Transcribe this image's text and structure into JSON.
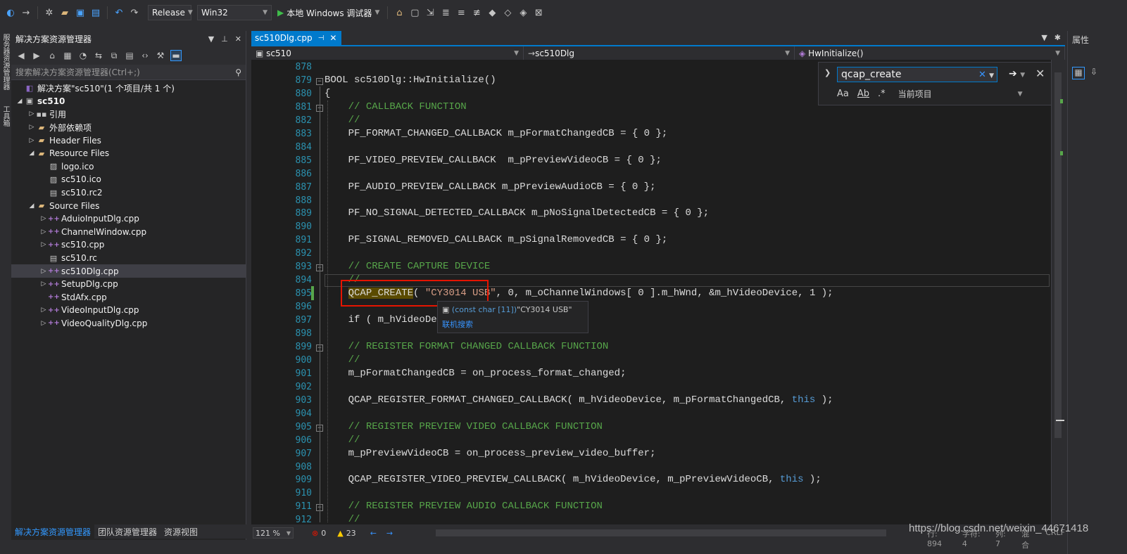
{
  "toolbar": {
    "config": "Release",
    "platform": "Win32",
    "run_label": "本地 Windows 调试器"
  },
  "left_strip": {
    "tabs": [
      "服务器资源管理器",
      "工具箱"
    ]
  },
  "solution_explorer": {
    "title": "解决方案资源管理器",
    "search_placeholder": "搜索解决方案资源管理器(Ctrl+;)",
    "tree": [
      {
        "label": "解决方案\"sc510\"(1 个项目/共 1 个)",
        "indent": 0,
        "twisty": "",
        "icon": "solution-icon",
        "selected": false
      },
      {
        "label": "sc510",
        "indent": 0,
        "twisty": "◢",
        "icon": "project-icon",
        "selected": false
      },
      {
        "label": "引用",
        "indent": 1,
        "twisty": "▷",
        "icon": "references-icon",
        "selected": false
      },
      {
        "label": "外部依赖项",
        "indent": 1,
        "twisty": "▷",
        "icon": "folder-icon",
        "selected": false
      },
      {
        "label": "Header Files",
        "indent": 1,
        "twisty": "▷",
        "icon": "folder-icon",
        "selected": false
      },
      {
        "label": "Resource Files",
        "indent": 1,
        "twisty": "◢",
        "icon": "folder-icon",
        "selected": false
      },
      {
        "label": "logo.ico",
        "indent": 2,
        "twisty": "",
        "icon": "image-file-icon",
        "selected": false
      },
      {
        "label": "sc510.ico",
        "indent": 2,
        "twisty": "",
        "icon": "image-file-icon",
        "selected": false
      },
      {
        "label": "sc510.rc2",
        "indent": 2,
        "twisty": "",
        "icon": "resource-file-icon",
        "selected": false
      },
      {
        "label": "Source Files",
        "indent": 1,
        "twisty": "◢",
        "icon": "folder-icon",
        "selected": false
      },
      {
        "label": "AduioInputDlg.cpp",
        "indent": 2,
        "twisty": "▷",
        "icon": "cpp-file-icon",
        "selected": false
      },
      {
        "label": "ChannelWindow.cpp",
        "indent": 2,
        "twisty": "▷",
        "icon": "cpp-file-icon",
        "selected": false
      },
      {
        "label": "sc510.cpp",
        "indent": 2,
        "twisty": "▷",
        "icon": "cpp-file-icon",
        "selected": false
      },
      {
        "label": "sc510.rc",
        "indent": 2,
        "twisty": "",
        "icon": "resource-file-icon",
        "selected": false
      },
      {
        "label": "sc510Dlg.cpp",
        "indent": 2,
        "twisty": "▷",
        "icon": "cpp-file-icon",
        "selected": true
      },
      {
        "label": "SetupDlg.cpp",
        "indent": 2,
        "twisty": "▷",
        "icon": "cpp-file-icon",
        "selected": false
      },
      {
        "label": "StdAfx.cpp",
        "indent": 2,
        "twisty": "",
        "icon": "cpp-file-icon",
        "selected": false
      },
      {
        "label": "VideoInputDlg.cpp",
        "indent": 2,
        "twisty": "▷",
        "icon": "cpp-file-icon",
        "selected": false
      },
      {
        "label": "VideoQualityDlg.cpp",
        "indent": 2,
        "twisty": "▷",
        "icon": "cpp-file-icon",
        "selected": false
      }
    ],
    "bottom_tabs": [
      "解决方案资源管理器",
      "团队资源管理器",
      "资源视图"
    ]
  },
  "editor": {
    "tab_label": "sc510Dlg.cpp",
    "nav": {
      "project": "sc510",
      "class": "sc510Dlg",
      "member": "HwInitialize()"
    },
    "lines": [
      {
        "n": "878",
        "html": ""
      },
      {
        "n": "879",
        "html": "BOOL sc510Dlg::HwInitialize()"
      },
      {
        "n": "880",
        "html": "{"
      },
      {
        "n": "881",
        "html": "    <span class=\"cm\">// CALLBACK FUNCTION</span>"
      },
      {
        "n": "882",
        "html": "    <span class=\"cm\">//</span>"
      },
      {
        "n": "883",
        "html": "    PF_FORMAT_CHANGED_CALLBACK m_pFormatChangedCB = { 0 };"
      },
      {
        "n": "884",
        "html": ""
      },
      {
        "n": "885",
        "html": "    PF_VIDEO_PREVIEW_CALLBACK  m_pPreviewVideoCB = { 0 };"
      },
      {
        "n": "886",
        "html": ""
      },
      {
        "n": "887",
        "html": "    PF_AUDIO_PREVIEW_CALLBACK m_pPreviewAudioCB = { 0 };"
      },
      {
        "n": "888",
        "html": ""
      },
      {
        "n": "889",
        "html": "    PF_NO_SIGNAL_DETECTED_CALLBACK m_pNoSignalDetectedCB = { 0 };"
      },
      {
        "n": "890",
        "html": ""
      },
      {
        "n": "891",
        "html": "    PF_SIGNAL_REMOVED_CALLBACK m_pSignalRemovedCB = { 0 };"
      },
      {
        "n": "892",
        "html": ""
      },
      {
        "n": "893",
        "html": "    <span class=\"cm\">// CREATE CAPTURE DEVICE</span>"
      },
      {
        "n": "894",
        "html": "    <span class=\"cm\">//</span>"
      },
      {
        "n": "895",
        "html": "    <span class=\"fn-hl\">QCAP_CREATE</span>( <span class=\"str\">\"CY3014 USB\"</span>, 0, m_oChannelWindows[ 0 ].m_hWnd, &amp;m_hVideoDevice, 1 );"
      },
      {
        "n": "896",
        "html": ""
      },
      {
        "n": "897",
        "html": "    if ( m_hVideoDevi"
      },
      {
        "n": "898",
        "html": ""
      },
      {
        "n": "899",
        "html": "    <span class=\"cm\">// REGISTER FORMAT CHANGED CALLBACK FUNCTION</span>"
      },
      {
        "n": "900",
        "html": "    <span class=\"cm\">//</span>"
      },
      {
        "n": "901",
        "html": "    m_pFormatChangedCB = on_process_format_changed;"
      },
      {
        "n": "902",
        "html": ""
      },
      {
        "n": "903",
        "html": "    QCAP_REGISTER_FORMAT_CHANGED_CALLBACK( m_hVideoDevice, m_pFormatChangedCB, <span class=\"kw\">this</span> );"
      },
      {
        "n": "904",
        "html": ""
      },
      {
        "n": "905",
        "html": "    <span class=\"cm\">// REGISTER PREVIEW VIDEO CALLBACK FUNCTION</span>"
      },
      {
        "n": "906",
        "html": "    <span class=\"cm\">//</span>"
      },
      {
        "n": "907",
        "html": "    m_pPreviewVideoCB = on_process_preview_video_buffer;"
      },
      {
        "n": "908",
        "html": ""
      },
      {
        "n": "909",
        "html": "    QCAP_REGISTER_VIDEO_PREVIEW_CALLBACK( m_hVideoDevice, m_pPreviewVideoCB, <span class=\"kw\">this</span> );"
      },
      {
        "n": "910",
        "html": ""
      },
      {
        "n": "911",
        "html": "    <span class=\"cm\">// REGISTER PREVIEW AUDIO CALLBACK FUNCTION</span>"
      },
      {
        "n": "912",
        "html": "    <span class=\"cm\">//</span>"
      }
    ],
    "tooltip": {
      "signature": "(const char [11])",
      "value": "\"CY3014 USB\"",
      "link": "联机搜索"
    },
    "find": {
      "query": "qcap_create",
      "scope": "当前项目"
    }
  },
  "properties": {
    "title": "属性"
  },
  "status": {
    "zoom": "121 %",
    "errors": "0",
    "warnings": "23",
    "line": "行: 894",
    "char": "字符: 4",
    "col": "列: 7",
    "mode": "混合",
    "eol": "CRLF"
  },
  "watermark": "https://blog.csdn.net/weixin_44671418"
}
